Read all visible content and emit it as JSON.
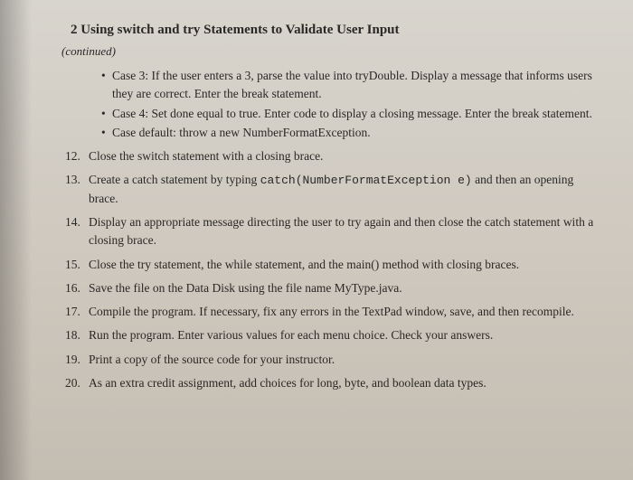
{
  "header": {
    "number": "2",
    "title": "Using switch and try Statements to Validate User Input",
    "continued": "(continued)"
  },
  "bullets": [
    "Case 3: If the user enters a 3, parse the value into tryDouble. Display a message that informs users they are correct. Enter the break statement.",
    "Case 4: Set done equal to true. Enter code to display a closing message. Enter the break statement.",
    "Case default: throw a new NumberFormatException."
  ],
  "items": [
    {
      "num": "12.",
      "text": "Close the switch statement with a closing brace."
    },
    {
      "num": "13.",
      "text_before": "Create a catch statement by typing ",
      "code": "catch(NumberFormatException e)",
      "text_after": " and then an opening brace."
    },
    {
      "num": "14.",
      "text": "Display an appropriate message directing the user to try again and then close the catch statement with a closing brace."
    },
    {
      "num": "15.",
      "text": "Close the try statement, the while statement, and the main() method with closing braces."
    },
    {
      "num": "16.",
      "text": "Save the file on the Data Disk using the file name MyType.java."
    },
    {
      "num": "17.",
      "text": "Compile the program. If necessary, fix any errors in the TextPad window, save, and then recompile."
    },
    {
      "num": "18.",
      "text": "Run the program. Enter various values for each menu choice. Check your answers."
    },
    {
      "num": "19.",
      "text": "Print a copy of the source code for your instructor."
    },
    {
      "num": "20.",
      "text": "As an extra credit assignment, add choices for long, byte, and boolean data types."
    }
  ]
}
